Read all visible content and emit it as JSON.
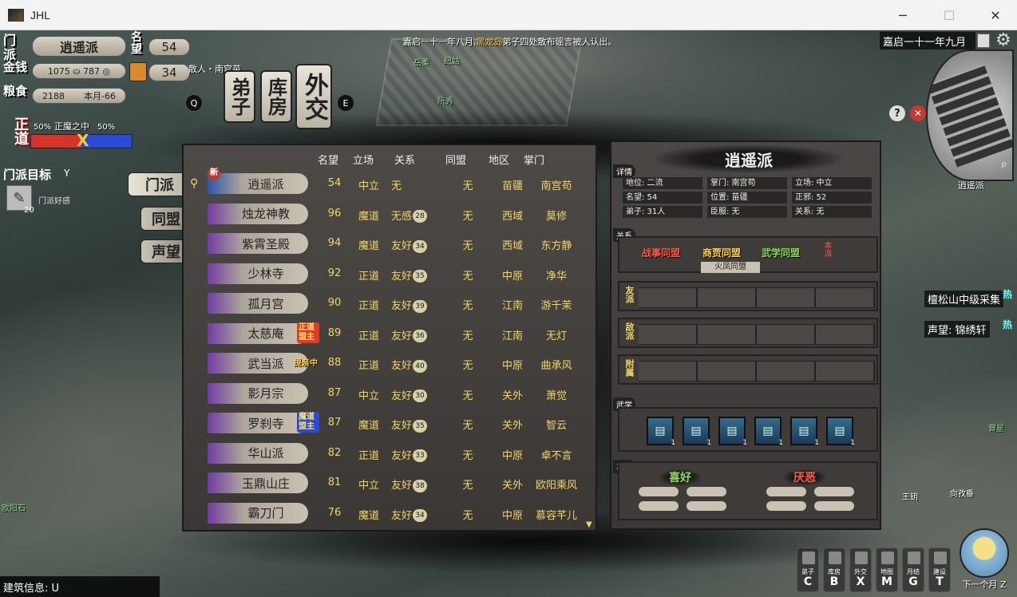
{
  "window": {
    "title": "JHL",
    "minimize": "─",
    "maximize": "☐",
    "close": "✕"
  },
  "status": {
    "sect_label": "门派",
    "sect_name": "逍遥派",
    "fame_label": "名望",
    "fame": "54",
    "money_label": "金钱",
    "money": "1075 ⛀ 787 ◎",
    "reputation": "34",
    "grain_label": "粮食",
    "grain": "2188",
    "grain_month": "本月-66",
    "alignment": {
      "left_label": "正道",
      "left_pct": "50%",
      "center": "正魔之中",
      "right_pct": "50%",
      "marker": "X"
    }
  },
  "goal": {
    "title": "门派目标",
    "key": "Y",
    "count": "20",
    "text": "门派好感"
  },
  "npc_label": "散人・南宫苗",
  "top_tabs": {
    "disciple": "弟子",
    "storage": "库房",
    "diplomacy": "外交",
    "prev_key": "Q",
    "next_key": "E"
  },
  "news": {
    "prefix": "嘉启一十一年八月,",
    "highlight": "黑龙岛",
    "suffix": "弟子四处散布谣言被人认出。"
  },
  "date": "嘉启一十一年九月",
  "minimap": {
    "label": "逍遥派",
    "help": "?",
    "close": "✕",
    "search": "⌕"
  },
  "side_tabs": {
    "sect": "门派",
    "alliance": "同盟",
    "fame": "声望"
  },
  "list": {
    "headers": {
      "fame": "名望",
      "stance": "立场",
      "relation": "关系",
      "alliance": "同盟",
      "region": "地区",
      "leader": "掌门"
    },
    "rows": [
      {
        "name": "逍遥派",
        "fame": "54",
        "stance": "中立",
        "relation": "无",
        "heart": "",
        "alliance": "无",
        "region": "苗疆",
        "leader": "南宫苟",
        "badge": "新"
      },
      {
        "name": "烛龙神教",
        "fame": "96",
        "stance": "魔道",
        "relation": "无感",
        "heart": "28",
        "alliance": "无",
        "region": "西域",
        "leader": "莫修",
        "badge": ""
      },
      {
        "name": "紫霄圣殿",
        "fame": "94",
        "stance": "魔道",
        "relation": "友好",
        "heart": "34",
        "alliance": "无",
        "region": "西域",
        "leader": "东方静",
        "badge": ""
      },
      {
        "name": "少林寺",
        "fame": "92",
        "stance": "正道",
        "relation": "友好",
        "heart": "35",
        "alliance": "无",
        "region": "中原",
        "leader": "净华",
        "badge": ""
      },
      {
        "name": "孤月宫",
        "fame": "90",
        "stance": "正道",
        "relation": "友好",
        "heart": "39",
        "alliance": "无",
        "region": "江南",
        "leader": "游千茉",
        "badge": ""
      },
      {
        "name": "太慈庵",
        "fame": "89",
        "stance": "正道",
        "relation": "友好",
        "heart": "36",
        "alliance": "无",
        "region": "江南",
        "leader": "无灯",
        "badge": "正道盟主"
      },
      {
        "name": "武当派",
        "fame": "88",
        "stance": "正道",
        "relation": "友好",
        "heart": "40",
        "alliance": "无",
        "region": "中原",
        "leader": "曲承风",
        "badge": "提亲中"
      },
      {
        "name": "影月宗",
        "fame": "87",
        "stance": "中立",
        "relation": "友好",
        "heart": "30",
        "alliance": "无",
        "region": "关外",
        "leader": "萧觉",
        "badge": ""
      },
      {
        "name": "罗刹寺",
        "fame": "87",
        "stance": "魔道",
        "relation": "友好",
        "heart": "35",
        "alliance": "无",
        "region": "关外",
        "leader": "智云",
        "badge": "魔道盟主"
      },
      {
        "name": "华山派",
        "fame": "82",
        "stance": "正道",
        "relation": "友好",
        "heart": "33",
        "alliance": "无",
        "region": "中原",
        "leader": "卓不言",
        "badge": ""
      },
      {
        "name": "玉鼎山庄",
        "fame": "81",
        "stance": "中立",
        "relation": "友好",
        "heart": "38",
        "alliance": "无",
        "region": "关外",
        "leader": "欧阳乘风",
        "badge": ""
      },
      {
        "name": "霸刀门",
        "fame": "76",
        "stance": "魔道",
        "relation": "友好",
        "heart": "34",
        "alliance": "无",
        "region": "中原",
        "leader": "慕容芊儿",
        "badge": ""
      }
    ]
  },
  "detail": {
    "title": "逍遥派",
    "sections": {
      "info": "详情",
      "relations": "关系",
      "skills": "武学",
      "prefs": "喜恶"
    },
    "info": [
      "地位: 二流",
      "掌门: 南宫苟",
      "立场: 中立",
      "名望: 54",
      "位置: 苗疆",
      "正邪: 52",
      "弟子: 31人",
      "臣服: 无",
      "关系: 无"
    ],
    "alliances": {
      "war": "战事同盟",
      "trade": "商贾同盟",
      "martial": "武学同盟",
      "fire": "火凤同盟",
      "side": "本派"
    },
    "rel_rows": {
      "friend": "友派",
      "enemy": "敌派",
      "vassal": "附属"
    },
    "skill_count": "1",
    "likes": "喜好",
    "dislikes": "厌恶"
  },
  "tasks": [
    {
      "text": "檀松山中级采集",
      "heat": "热"
    },
    {
      "text": "声望: 锦绣轩",
      "heat": "热"
    }
  ],
  "map_labels": {
    "a": "江湖",
    "b": "岳柔",
    "c": "纪姑",
    "d": "阮秀",
    "e": "欧阳石",
    "f": "曾星",
    "g": "向孜垂",
    "h": "王钥"
  },
  "bottom": {
    "build_info": "建筑信息: U",
    "buttons": [
      {
        "label": "弟子",
        "key": "C"
      },
      {
        "label": "库房",
        "key": "B"
      },
      {
        "label": "外交",
        "key": "X"
      },
      {
        "label": "地图",
        "key": "M"
      },
      {
        "label": "月结",
        "key": "G"
      },
      {
        "label": "建设",
        "key": "T"
      }
    ],
    "next_month": "下一个月 Z"
  }
}
